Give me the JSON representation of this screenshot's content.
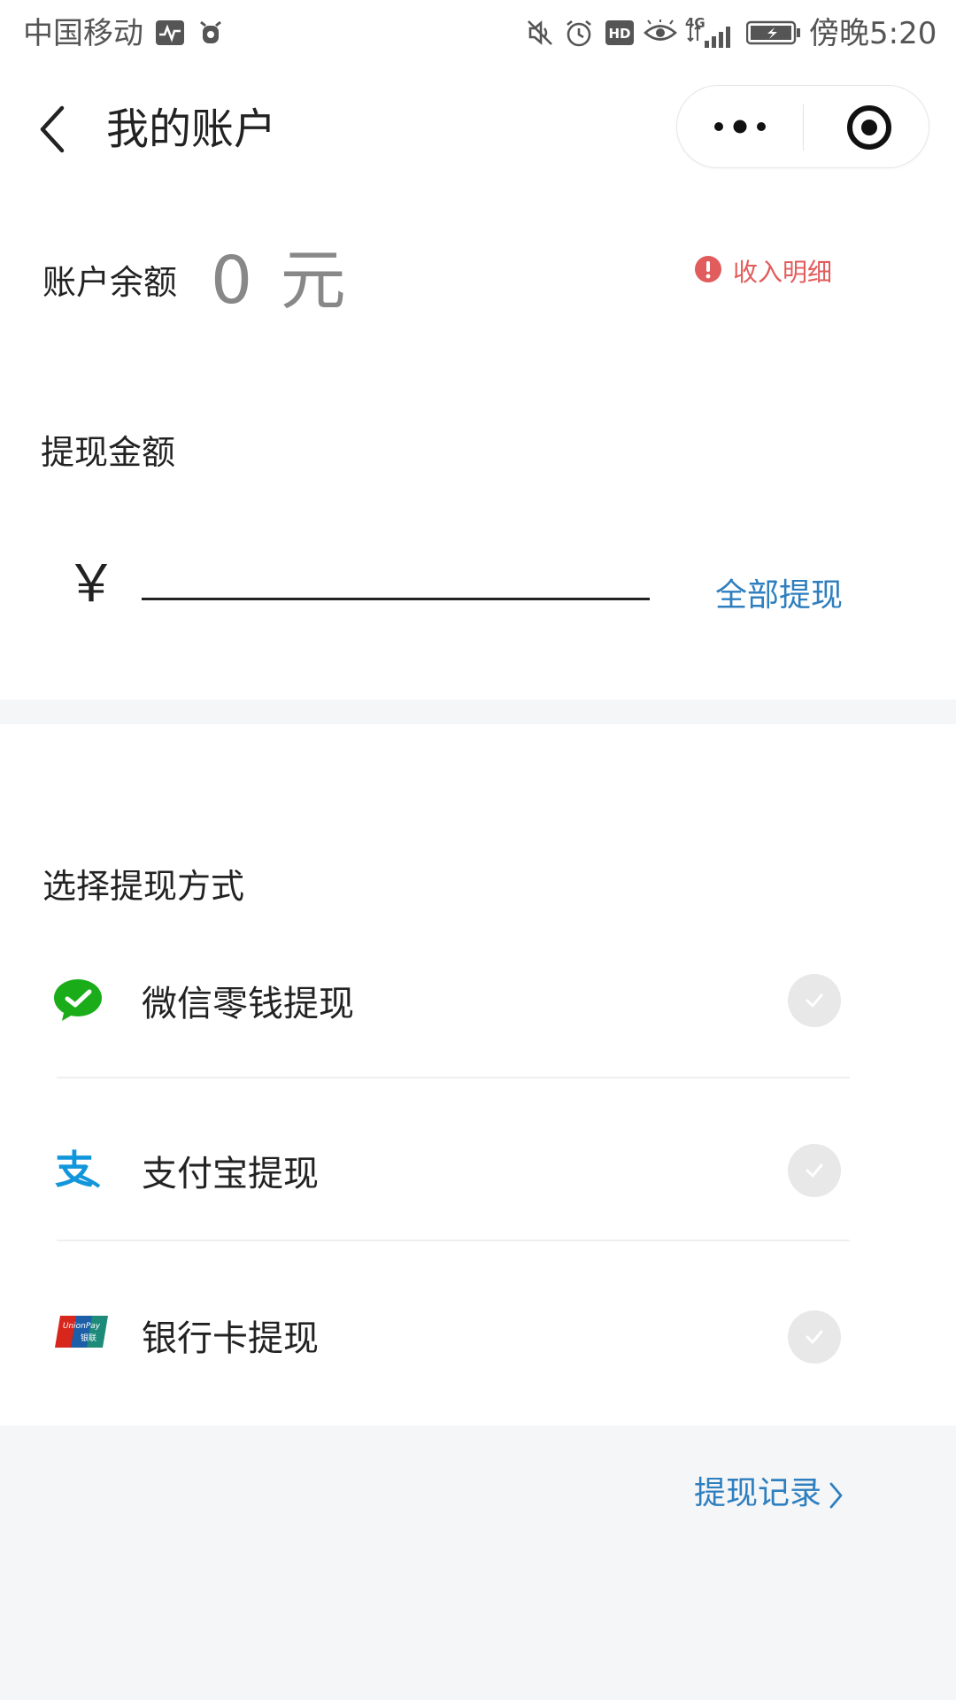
{
  "status_bar": {
    "carrier": "中国移动",
    "network": "4G",
    "time": "傍晚5:20",
    "icons": [
      "activity-icon",
      "alarm-app-icon",
      "mute-icon",
      "alarm-icon",
      "hd-icon",
      "eye-icon",
      "signal-icon",
      "battery-icon"
    ]
  },
  "nav": {
    "title": "我的账户",
    "back_icon": "chevron-left-icon",
    "more_icon": "more-dots-icon",
    "close_icon": "target-icon"
  },
  "balance": {
    "label": "账户余额",
    "amount": "0 元",
    "income_link": "收入明细",
    "income_icon": "exclamation-icon"
  },
  "withdraw": {
    "label": "提现金额",
    "currency": "￥",
    "amount_value": "",
    "withdraw_all": "全部提现"
  },
  "methods": {
    "title": "选择提现方式",
    "items": [
      {
        "label": "微信零钱提现",
        "icon": "wechat-icon"
      },
      {
        "label": "支付宝提现",
        "icon": "alipay-icon"
      },
      {
        "label": "银行卡提现",
        "icon": "unionpay-icon"
      }
    ]
  },
  "records": {
    "label": "提现记录",
    "arrow": "chevron-right-icon"
  },
  "colors": {
    "accent_blue": "#2e7fbf",
    "income_red": "#e15c5c",
    "wechat_green": "#1aad19",
    "alipay_blue": "#1296db",
    "background": "#f5f6f8"
  }
}
